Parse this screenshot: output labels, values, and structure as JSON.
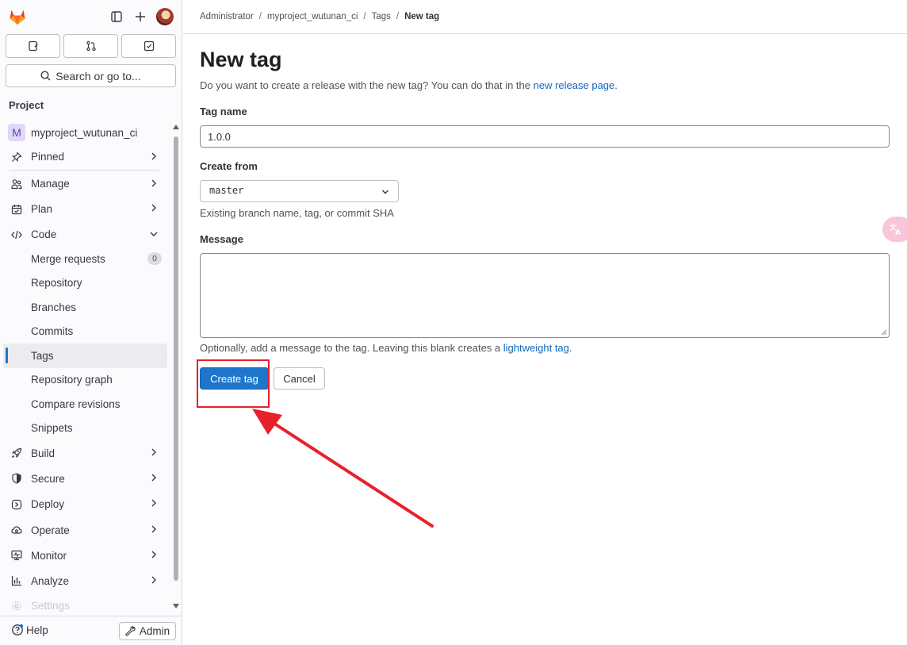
{
  "topbar": {
    "logo": "gitlab-tanuki-logo",
    "icons": [
      "sidebar-toggle-icon",
      "plus-icon",
      "user-avatar"
    ]
  },
  "quick_actions": [
    "issues-icon",
    "merge-requests-icon",
    "todo-icon"
  ],
  "search": {
    "label": "Search or go to..."
  },
  "sidebar": {
    "section_label": "Project",
    "project": {
      "initial": "M",
      "name": "myproject_wutunan_ci"
    },
    "pinned": "Pinned",
    "items": [
      {
        "label": "Manage",
        "icon": "manage-icon"
      },
      {
        "label": "Plan",
        "icon": "plan-icon"
      },
      {
        "label": "Code",
        "icon": "code-icon",
        "expanded": true
      }
    ],
    "code_subitems": [
      {
        "label": "Merge requests",
        "badge": "0"
      },
      {
        "label": "Repository"
      },
      {
        "label": "Branches"
      },
      {
        "label": "Commits"
      },
      {
        "label": "Tags",
        "active": true
      },
      {
        "label": "Repository graph"
      },
      {
        "label": "Compare revisions"
      },
      {
        "label": "Snippets"
      }
    ],
    "more_items": [
      {
        "label": "Build",
        "icon": "rocket-icon"
      },
      {
        "label": "Secure",
        "icon": "shield-icon"
      },
      {
        "label": "Deploy",
        "icon": "deploy-icon"
      },
      {
        "label": "Operate",
        "icon": "cloud-gear-icon"
      },
      {
        "label": "Monitor",
        "icon": "monitor-icon"
      },
      {
        "label": "Analyze",
        "icon": "chart-icon"
      }
    ],
    "cut_off_item": "Settings"
  },
  "bottom": {
    "help": "Help",
    "admin": "Admin"
  },
  "breadcrumb": [
    "Administrator",
    "myproject_wutunan_ci",
    "Tags",
    "New tag"
  ],
  "form": {
    "title": "New tag",
    "intro_prefix": "Do you want to create a release with the new tag? You can do that in the ",
    "intro_link": "new release page",
    "intro_suffix": ".",
    "tag_name_label": "Tag name",
    "tag_name_value": "1.0.0",
    "create_from_label": "Create from",
    "create_from_value": "master",
    "create_from_hint": "Existing branch name, tag, or commit SHA",
    "message_label": "Message",
    "message_value": "",
    "message_hint_prefix": "Optionally, add a message to the tag. Leaving this blank creates a ",
    "message_hint_link": "lightweight tag",
    "message_hint_suffix": ".",
    "create_button": "Create tag",
    "cancel_button": "Cancel"
  },
  "annotation": {
    "color": "#e8202a"
  },
  "colors": {
    "primary": "#1f75cb",
    "link": "#1068bf",
    "active_marker": "#1f75cb"
  }
}
